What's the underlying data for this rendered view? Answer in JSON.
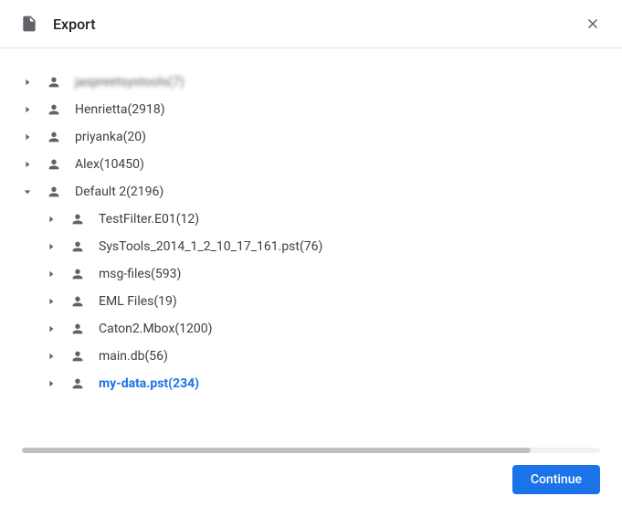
{
  "header": {
    "title": "Export",
    "icon": "document-icon",
    "close_icon": "close-icon"
  },
  "tree": {
    "items": [
      {
        "label": "jaspreetsystools(7)",
        "expanded": false,
        "level": 0,
        "obscured": true
      },
      {
        "label": "Henrietta(2918)",
        "expanded": false,
        "level": 0
      },
      {
        "label": "priyanka(20)",
        "expanded": false,
        "level": 0
      },
      {
        "label": "Alex(10450)",
        "expanded": false,
        "level": 0
      },
      {
        "label": "Default 2(2196)",
        "expanded": true,
        "level": 0
      },
      {
        "label": "TestFilter.E01(12)",
        "expanded": false,
        "level": 1
      },
      {
        "label": "SysTools_2014_1_2_10_17_161.pst(76)",
        "expanded": false,
        "level": 1
      },
      {
        "label": "msg-files(593)",
        "expanded": false,
        "level": 1
      },
      {
        "label": "EML Files(19)",
        "expanded": false,
        "level": 1
      },
      {
        "label": "Caton2.Mbox(1200)",
        "expanded": false,
        "level": 1
      },
      {
        "label": "main.db(56)",
        "expanded": false,
        "level": 1
      },
      {
        "label": "my-data.pst(234)",
        "expanded": false,
        "level": 1,
        "selected": true
      }
    ]
  },
  "footer": {
    "continue_label": "Continue"
  },
  "colors": {
    "accent": "#1a73e8",
    "text": "#3c4043",
    "muted": "#5f6368",
    "border": "#e0e0e0"
  }
}
